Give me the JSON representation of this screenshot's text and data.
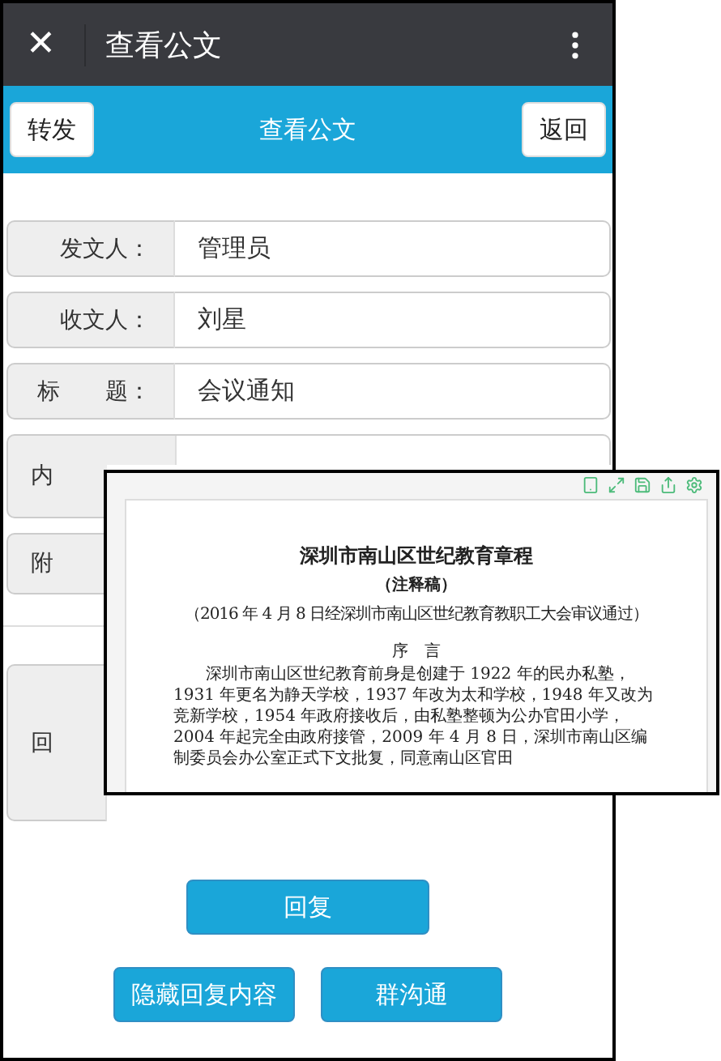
{
  "top_bar": {
    "close": "✕",
    "title": "查看公文"
  },
  "header": {
    "left_button": "转发",
    "title": "查看公文",
    "right_button": "返回"
  },
  "rows": [
    {
      "kind": "field",
      "label": "发文人：",
      "value": "管理员"
    },
    {
      "kind": "field",
      "label": "收文人：",
      "value": "刘星"
    },
    {
      "kind": "field",
      "label": "标　　题：",
      "value": "会议通知"
    },
    {
      "kind": "content",
      "label": "内"
    },
    {
      "kind": "attachment",
      "label": "附"
    },
    {
      "kind": "reply",
      "label": "回"
    }
  ],
  "primary_action": "回复",
  "secondary_actions": [
    "隐藏回复内容",
    "群沟通"
  ],
  "preview": {
    "title": "深圳市南山区世纪教育章程",
    "subtitle": "（注释稿）",
    "date_line": "（2016 年 4 月 8 日经深圳市南山区世纪教育教职工大会审议通过）",
    "heading": "序　言",
    "paragraph": "深圳市南山区世纪教育前身是创建于 1922 年的民办私塾，1931 年更名为静天学校，1937 年改为太和学校，1948 年又改为竞新学校，1954 年政府接收后，由私塾整顿为公办官田小学，2004 年起完全由政府接管，2009 年 4 月 8 日，深圳市南山区编制委员会办公室正式下文批复，同意南山区官田"
  }
}
